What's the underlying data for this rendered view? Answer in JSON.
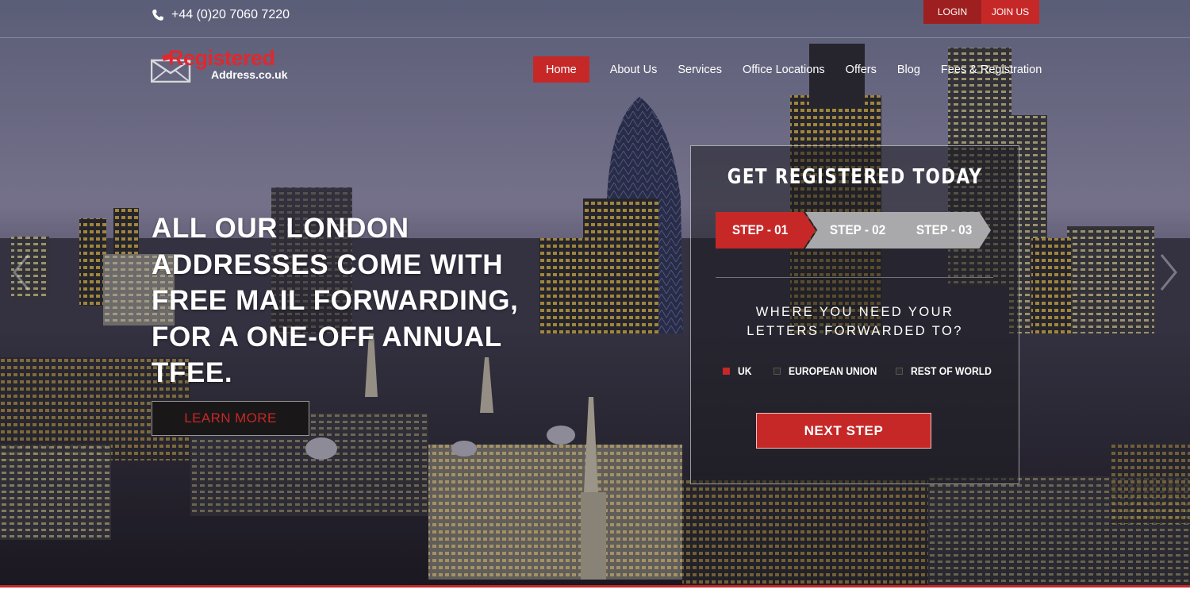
{
  "topbar": {
    "phone": "+44 (0)20 7060 7220",
    "login_label": "LOGIN",
    "join_label": "JOIN US"
  },
  "logo": {
    "brand": "Registered",
    "domain": "Address.co.uk"
  },
  "nav": {
    "items": [
      {
        "label": "Home",
        "active": true
      },
      {
        "label": "About Us"
      },
      {
        "label": "Services"
      },
      {
        "label": "Office Locations"
      },
      {
        "label": "Offers"
      },
      {
        "label": "Blog"
      },
      {
        "label": "Fees & Registration"
      }
    ]
  },
  "hero": {
    "headline": "ALL OUR LONDON ADDRESSES COME WITH FREE MAIL FORWARDING, FOR A ONE-OFF ANNUAL TFEE.",
    "learn_more_label": "LEARN MORE"
  },
  "registration": {
    "title": "GET REGISTERED TODAY",
    "steps": [
      {
        "label": "STEP - 01",
        "active": true
      },
      {
        "label": "STEP - 02"
      },
      {
        "label": "STEP - 03"
      }
    ],
    "question": "WHERE YOU NEED YOUR LETTERS FORWARDED TO?",
    "options": [
      {
        "label": "UK",
        "checked": true
      },
      {
        "label": "EUROPEAN UNION",
        "checked": false
      },
      {
        "label": "REST OF WORLD",
        "checked": false
      }
    ],
    "next_label": "NEXT STEP"
  },
  "colors": {
    "accent": "#c62828",
    "accent_dark": "#9e1f1f",
    "step_inactive": "#a9a9ab"
  },
  "icons": {
    "phone": "phone-icon",
    "logo": "envelope-icon",
    "prev": "chevron-left-icon",
    "next": "chevron-right-icon"
  }
}
